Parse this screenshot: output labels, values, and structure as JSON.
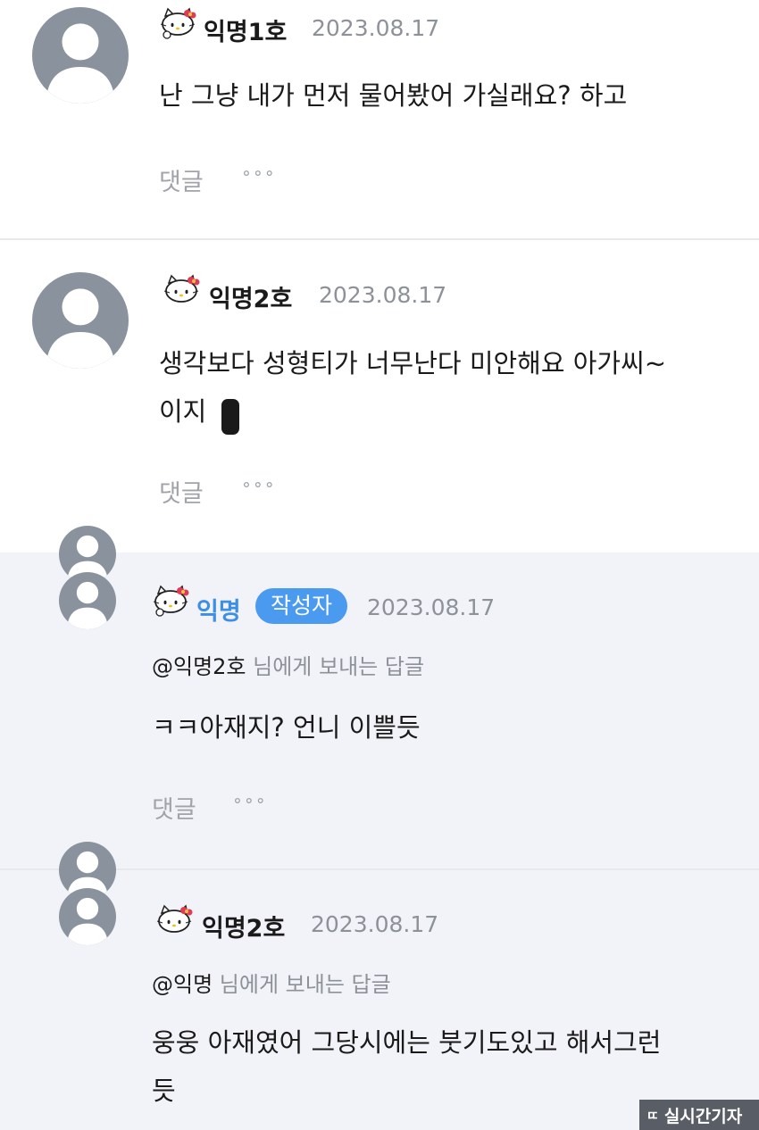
{
  "icons": {
    "avatar": "person-silhouette-icon",
    "nick_badge": "hello-kitty-icon",
    "more": "more-dots-icon"
  },
  "colors": {
    "author_accent": "#3c8ee6",
    "badge_bg": "#4a9af0",
    "reply_bg": "#f1f3f8",
    "avatar_bg": "#8a929d"
  },
  "comments": [
    {
      "nickname": "익명1호",
      "date": "2023.08.17",
      "text": "난 그냥 내가 먼저 물어봤어 가실래요? 하고",
      "reply_label": "댓글",
      "more": "∘∘∘"
    },
    {
      "nickname": "익명2호",
      "date": "2023.08.17",
      "text_line1": "생각보다 성형티가 너무난다 미안해요 아가씨~",
      "text_line2": "이지",
      "reply_label": "댓글",
      "more": "∘∘∘"
    }
  ],
  "replies": [
    {
      "nickname": "익명",
      "badge": "작성자",
      "date": "2023.08.17",
      "reply_to_mention": "@익명2호",
      "reply_to_suffix": " 님에게 보내는 답글",
      "text": "ㅋㅋ아재지? 언니 이쁠듯",
      "reply_label": "댓글",
      "more": "∘∘∘"
    },
    {
      "nickname": "익명2호",
      "date": "2023.08.17",
      "reply_to_mention": "@익명",
      "reply_to_suffix": " 님에게 보내는 답글",
      "text_line1": "웅웅 아재였어 그당시에는 붓기도있고 해서그런",
      "text_line2": "듯"
    }
  ],
  "watermark": {
    "logo": "ㄸ",
    "text": "실시간기자"
  }
}
